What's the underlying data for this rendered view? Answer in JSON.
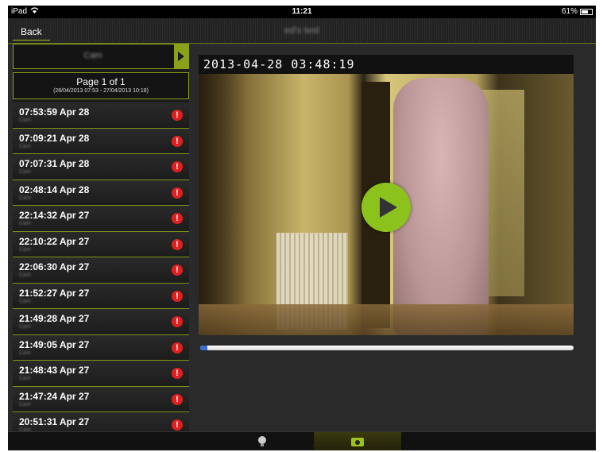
{
  "statusbar": {
    "carrier": "iPad",
    "time": "11:21",
    "battery": "61%"
  },
  "navbar": {
    "back_label": "Back",
    "title": "ed's test"
  },
  "sidebar": {
    "camera_label": "Cam",
    "page_label": "Page 1 of 1",
    "page_range": "(28/04/2013 07:53 - 27/04/2013 10:18)",
    "events": [
      {
        "time": "07:53:59 Apr 28",
        "sub": "Cam"
      },
      {
        "time": "07:09:21 Apr 28",
        "sub": "Cam"
      },
      {
        "time": "07:07:31 Apr 28",
        "sub": "Cam"
      },
      {
        "time": "02:48:14 Apr 28",
        "sub": "Cam"
      },
      {
        "time": "22:14:32 Apr 27",
        "sub": "Cam"
      },
      {
        "time": "22:10:22 Apr 27",
        "sub": "Cam"
      },
      {
        "time": "22:06:30 Apr 27",
        "sub": "Cam"
      },
      {
        "time": "21:52:27 Apr 27",
        "sub": "Cam"
      },
      {
        "time": "21:49:28 Apr 27",
        "sub": "Cam"
      },
      {
        "time": "21:49:05 Apr 27",
        "sub": "Cam"
      },
      {
        "time": "21:48:43 Apr 27",
        "sub": "Cam"
      },
      {
        "time": "21:47:24 Apr 27",
        "sub": "Cam"
      },
      {
        "time": "20:51:31 Apr 27",
        "sub": "Cam"
      }
    ],
    "alert_glyph": "!"
  },
  "video": {
    "timestamp": "2013-04-28 03:48:19",
    "progress": 0.02
  },
  "tabbar": {
    "tabs": [
      {
        "icon": "webcam-icon"
      },
      {
        "icon": "camera-icon"
      }
    ]
  },
  "colors": {
    "accent": "#8cc21c",
    "alert": "#e02020",
    "progress": "#3a6fd0"
  }
}
